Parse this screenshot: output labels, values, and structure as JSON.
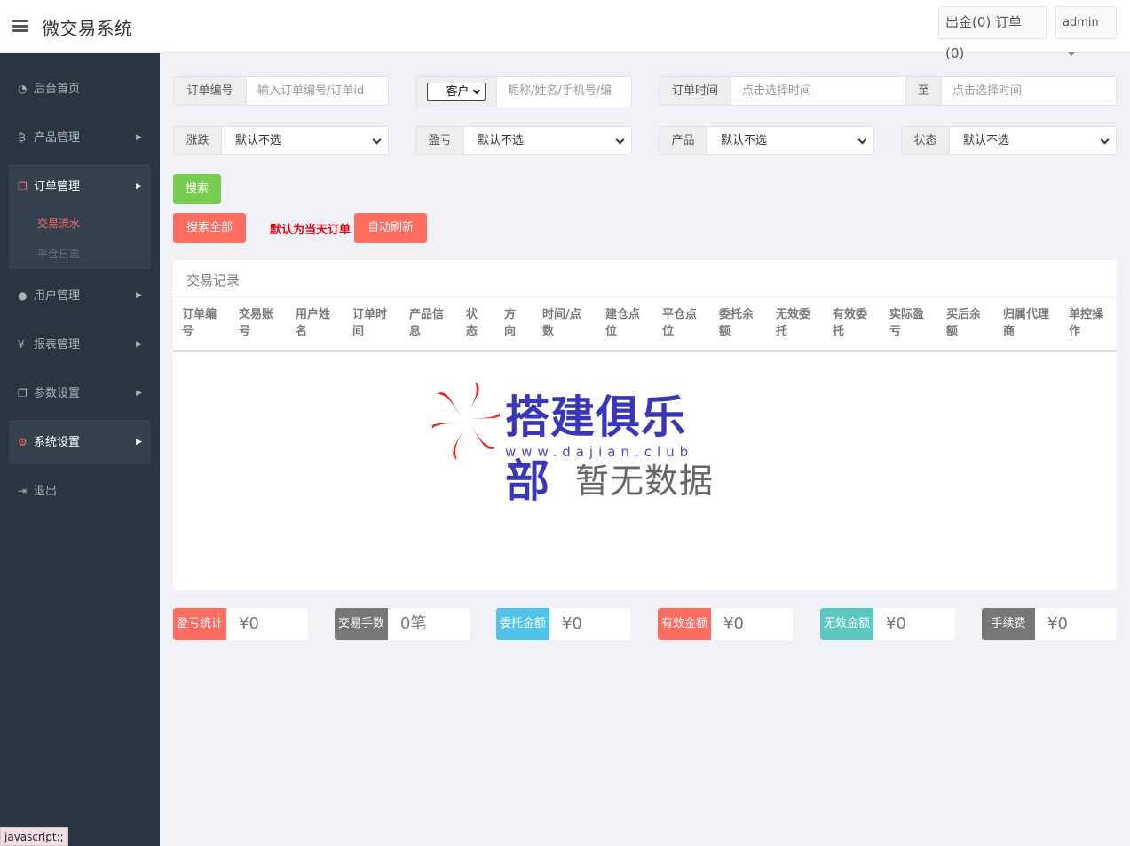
{
  "header": {
    "title": "微交易系统",
    "orders_button": "出金(0) 订单(0)",
    "user": "admin"
  },
  "sidebar": {
    "items": [
      {
        "label": "后台首页",
        "icon": "dashboard-icon"
      },
      {
        "label": "产品管理",
        "icon": "bitcoin-icon"
      },
      {
        "label": "订单管理",
        "icon": "copy-icon"
      },
      {
        "label": "用户管理",
        "icon": "user-icon"
      },
      {
        "label": "报表管理",
        "icon": "yen-icon"
      },
      {
        "label": "参数设置",
        "icon": "copy-icon"
      },
      {
        "label": "系统设置",
        "icon": "cogs-icon"
      },
      {
        "label": "退出",
        "icon": "sign-out-icon"
      }
    ],
    "submenu": [
      "交易流水",
      "平仓日志"
    ]
  },
  "filters": {
    "order_no_label": "订单编号",
    "order_no_placeholder": "输入订单编号/订单id",
    "customer_select": "客户",
    "customer_placeholder": "昵称/姓名/手机号/编",
    "order_time_label": "订单时间",
    "time_from_placeholder": "点击选择时间",
    "to_label": "至",
    "time_to_placeholder": "点击选择时间",
    "rise_fall_label": "涨跌",
    "profit_label": "盈亏",
    "product_label": "产品",
    "status_label": "状态",
    "default_option": "默认不选"
  },
  "actions": {
    "search": "搜索",
    "search_all": "搜索全部",
    "note": "默认为当天订单",
    "auto_refresh": "自动刷新"
  },
  "table": {
    "title": "交易记录",
    "columns": [
      [
        "订单编",
        "号"
      ],
      [
        "交易账",
        "号"
      ],
      [
        "用户姓",
        "名"
      ],
      [
        "订单时",
        "间"
      ],
      [
        "产品信",
        "息"
      ],
      [
        "状",
        "态"
      ],
      [
        "方",
        "向"
      ],
      [
        "时间/点",
        "数"
      ],
      [
        "建仓点",
        "位"
      ],
      [
        "平仓点",
        "位"
      ],
      [
        "委托余",
        "额"
      ],
      [
        "无效委",
        "托"
      ],
      [
        "有效委",
        "托"
      ],
      [
        "实际盈",
        "亏"
      ],
      [
        "买后余",
        "额"
      ],
      [
        "归属代理",
        "商"
      ],
      [
        "单控操",
        "作"
      ]
    ],
    "empty_text": "暂无数据"
  },
  "watermark": {
    "text": "搭建俱乐部",
    "url": "www.dajian.club"
  },
  "stats": [
    {
      "label": "盈亏统计",
      "value": "¥0",
      "color": "#ff6c60"
    },
    {
      "label": "交易手数",
      "value": "0笔",
      "color": "#777777"
    },
    {
      "label": "委托金额",
      "value": "¥0",
      "color": "#4fc3e9"
    },
    {
      "label": "有效金额",
      "value": "¥0",
      "color": "#ff6c60"
    },
    {
      "label": "无效金额",
      "value": "¥0",
      "color": "#5bc9c2"
    },
    {
      "label": "手续费",
      "value": "¥0",
      "color": "#777777"
    }
  ],
  "status_bar": "javascript:;"
}
